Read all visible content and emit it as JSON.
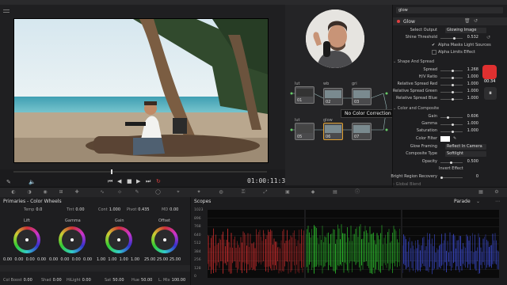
{
  "viewer": {
    "timecode": "01:00:11:37"
  },
  "nodes": {
    "labels": [
      "lut",
      "wb",
      "gri",
      "lut",
      "glow"
    ],
    "numbers": [
      "01",
      "02",
      "03",
      "05",
      "06",
      "07"
    ],
    "tooltip": "No Color Correction"
  },
  "inspector": {
    "search_value": "glow",
    "effect_title": "Glow",
    "select_output_label": "Select Output",
    "select_output_value": "Glowing Image",
    "shine_threshold_label": "Shine Threshold",
    "shine_threshold_value": "0.532",
    "alpha_masks_label": "Alpha Masks Light Sources",
    "alpha_limits_label": "Alpha Limits Effect",
    "shape_section": "Shape And Spread",
    "spread_label": "Spread",
    "spread_value": "1.268",
    "hv_ratio_label": "H/V Ratio",
    "hv_ratio_value": "1.000",
    "rel_red_label": "Relative Spread Red",
    "rel_red_value": "1.000",
    "rel_green_label": "Relative Spread Green",
    "rel_green_value": "1.000",
    "rel_blue_label": "Relative Spread Blue",
    "rel_blue_value": "1.000",
    "color_section": "Color and Composite",
    "gain_label": "Gain",
    "gain_value": "0.606",
    "gamma_label": "Gamma",
    "gamma_value": "1.000",
    "saturation_label": "Saturation",
    "saturation_value": "1.000",
    "color_filter_label": "Color Filter",
    "glow_framing_label": "Glow Framing",
    "glow_framing_value": "Reflect In Camera",
    "composite_type_label": "Composite Type",
    "composite_type_value": "Softlight",
    "opacity_label": "Opacity",
    "opacity_value": "0.500",
    "invert_effect_label": "Invert Effect",
    "bright_region_label": "Bright Region Recovery",
    "bright_region_value": "0",
    "global_blend_label": "Global Blend",
    "record_time": "00:34"
  },
  "primaries": {
    "title": "Primaries - Color Wheels",
    "temp_label": "Temp",
    "temp_value": "0.0",
    "tint_label": "Tint",
    "tint_value": "0.00",
    "cont_label": "Cont",
    "cont_value": "1.000",
    "pivot_label": "Pivot",
    "pivot_value": "0.435",
    "md_label": "MD",
    "md_value": "0.00",
    "wheels": [
      {
        "name": "Lift",
        "values": [
          "0.00",
          "0.00",
          "0.00",
          "0.00"
        ]
      },
      {
        "name": "Gamma",
        "values": [
          "0.00",
          "0.00",
          "0.00",
          "0.00"
        ]
      },
      {
        "name": "Gain",
        "values": [
          "1.00",
          "1.00",
          "1.00",
          "1.00"
        ]
      },
      {
        "name": "Offset",
        "values": [
          "25.00",
          "25.00",
          "25.00"
        ]
      }
    ],
    "boost_label": "Col Boost",
    "boost_value": "0.00",
    "shad_label": "Shad",
    "shad_value": "0.00",
    "hilight_label": "HiLight",
    "hilight_value": "0.00",
    "sat_label": "Sat",
    "sat_value": "50.00",
    "hue_label": "Hue",
    "hue_value": "50.00",
    "lmix_label": "L. Mix",
    "lmix_value": "100.00"
  },
  "scopes": {
    "title": "Scopes",
    "mode": "Parade",
    "scale": [
      "1023",
      "896",
      "768",
      "640",
      "512",
      "384",
      "256",
      "128",
      "0"
    ],
    "colors": {
      "red": "#e03030",
      "green": "#30d030",
      "blue": "#4050e0"
    }
  }
}
